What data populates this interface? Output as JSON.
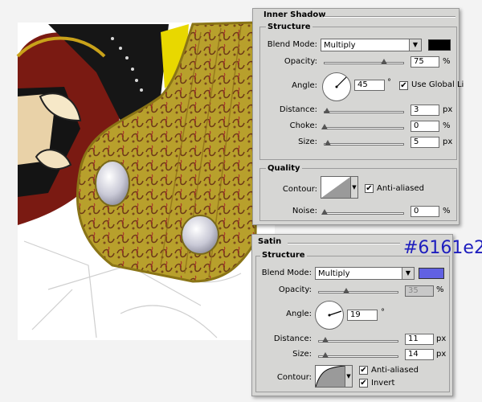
{
  "inner_shadow": {
    "title": "Inner Shadow",
    "structure_title": "Structure",
    "blend_mode_label": "Blend Mode:",
    "blend_mode_value": "Multiply",
    "color": "#000000",
    "opacity_label": "Opacity:",
    "opacity_value": "75",
    "opacity_unit": "%",
    "opacity_level": 0.75,
    "angle_label": "Angle:",
    "angle_value": "45",
    "angle_unit": "°",
    "use_global_light_label": "Use Global Li",
    "use_global_light_checked": true,
    "distance_label": "Distance:",
    "distance_value": "3",
    "distance_unit": "px",
    "choke_label": "Choke:",
    "choke_value": "0",
    "choke_unit": "%",
    "size_label": "Size:",
    "size_value": "5",
    "size_unit": "px",
    "quality_title": "Quality",
    "contour_label": "Contour:",
    "anti_aliased_label": "Anti-aliased",
    "anti_aliased_checked": true,
    "noise_label": "Noise:",
    "noise_value": "0",
    "noise_unit": "%"
  },
  "satin": {
    "title": "Satin",
    "structure_title": "Structure",
    "blend_mode_label": "Blend Mode:",
    "blend_mode_value": "Multiply",
    "color": "#6161e2",
    "opacity_label": "Opacity:",
    "opacity_value": "35",
    "opacity_unit": "%",
    "opacity_level": 0.35,
    "angle_label": "Angle:",
    "angle_value": "19",
    "angle_unit": "°",
    "distance_label": "Distance:",
    "distance_value": "11",
    "distance_unit": "px",
    "size_label": "Size:",
    "size_value": "14",
    "size_unit": "px",
    "contour_label": "Contour:",
    "anti_aliased_label": "Anti-aliased",
    "anti_aliased_checked": true,
    "invert_label": "Invert",
    "invert_checked": true
  },
  "annotation": {
    "hex_label": "#6161e2"
  },
  "icons": {
    "dropdown": "chevron-down-icon",
    "checkbox": "checkmark-icon"
  },
  "colors": {
    "panel_bg": "#d6d6d4",
    "gold": "#b9a12a",
    "dark_red": "#7a1a12"
  }
}
